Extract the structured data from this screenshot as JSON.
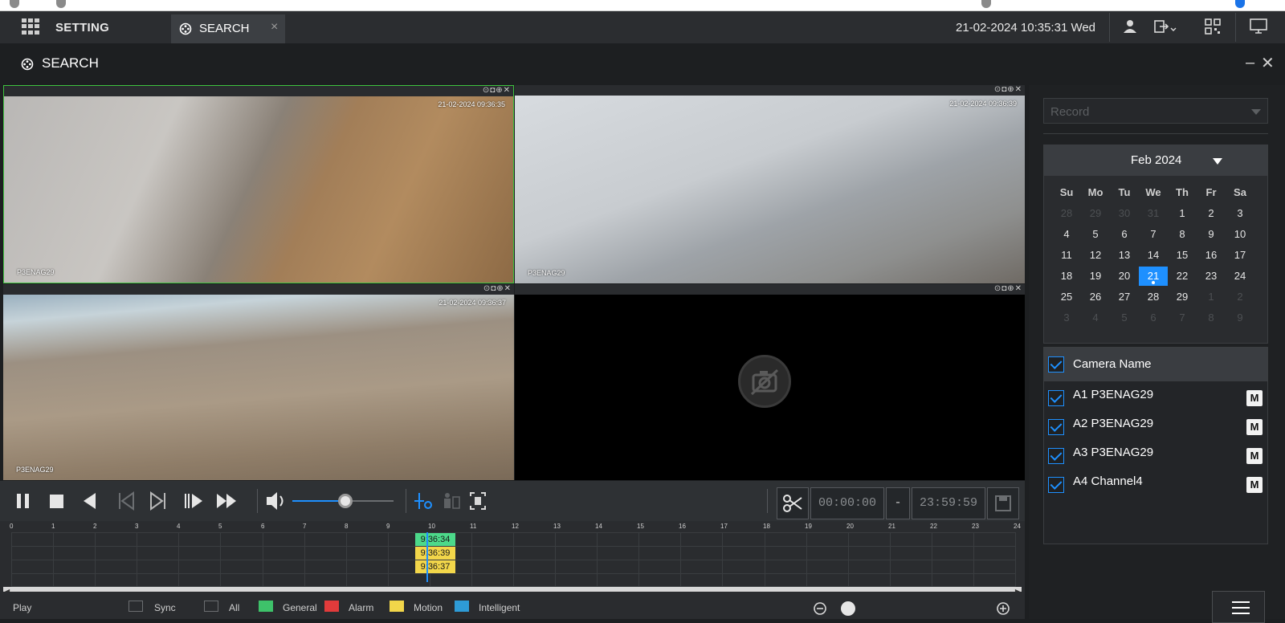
{
  "topbar": {
    "setting_label": "SETTING",
    "tab_label": "SEARCH",
    "tab_close": "×",
    "datetime": "21-02-2024 10:35:31 Wed"
  },
  "titlebar": {
    "title": "SEARCH",
    "minimize": "–",
    "close": "✕"
  },
  "panes": [
    {
      "osd_time": "21-02-2024 09:36:35",
      "osd_name": "P3ENAG29"
    },
    {
      "osd_time": "21-02-2024 09:36:39",
      "osd_name": "P3ENAG29"
    },
    {
      "osd_time": "21-02-2024 09:36:37",
      "osd_name": "P3ENAG29"
    },
    {
      "osd_time": "",
      "osd_name": ""
    }
  ],
  "pane_tools": "⊙◘⊕✕",
  "controls": {
    "volume_percent": 52,
    "clip_start": "00:00:00",
    "clip_dash": "-",
    "clip_end": "23:59:59"
  },
  "timeline": {
    "hours": [
      "0",
      "1",
      "2",
      "3",
      "4",
      "5",
      "6",
      "7",
      "8",
      "9",
      "10",
      "11",
      "12",
      "13",
      "14",
      "15",
      "16",
      "17",
      "18",
      "19",
      "20",
      "21",
      "22",
      "23",
      "24"
    ],
    "markers": [
      {
        "label": "9:36:34",
        "color": "#4cd98a"
      },
      {
        "label": "9:36:39",
        "color": "#f2d64a"
      },
      {
        "label": "9:36:37",
        "color": "#f2d64a"
      }
    ]
  },
  "legend": {
    "play": "Play",
    "sync": "Sync",
    "all": "All",
    "general": "General",
    "alarm": "Alarm",
    "motion": "Motion",
    "intelligent": "Intelligent",
    "colors": {
      "general": "#3ec26a",
      "alarm": "#e23b3b",
      "motion": "#f2d64a",
      "intelligent": "#2e9bd6"
    }
  },
  "record": {
    "placeholder": "Record"
  },
  "calendar": {
    "month": "Feb 2024",
    "weekdays": [
      "Su",
      "Mo",
      "Tu",
      "We",
      "Th",
      "Fr",
      "Sa"
    ],
    "selected": "21",
    "days": [
      [
        "28",
        "29",
        "30",
        "31",
        "1",
        "2",
        "3"
      ],
      [
        "4",
        "5",
        "6",
        "7",
        "8",
        "9",
        "10"
      ],
      [
        "11",
        "12",
        "13",
        "14",
        "15",
        "16",
        "17"
      ],
      [
        "18",
        "19",
        "20",
        "21",
        "22",
        "23",
        "24"
      ],
      [
        "25",
        "26",
        "27",
        "28",
        "29",
        "1",
        "2"
      ],
      [
        "3",
        "4",
        "5",
        "6",
        "7",
        "8",
        "9"
      ]
    ],
    "dim_first_row": 4,
    "dim_after_index_row5": 5
  },
  "cameras": {
    "header": "Camera Name",
    "items": [
      {
        "label": "A1 P3ENAG29",
        "m": "M"
      },
      {
        "label": "A2 P3ENAG29",
        "m": "M"
      },
      {
        "label": "A3 P3ENAG29",
        "m": "M"
      },
      {
        "label": "A4 Channel4",
        "m": "M"
      }
    ]
  },
  "accent": "#1e90ff"
}
